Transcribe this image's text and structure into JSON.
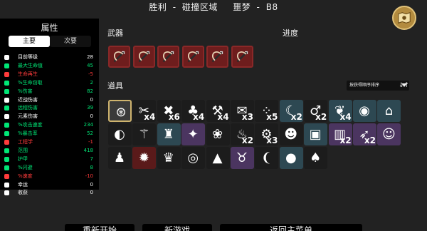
{
  "header": {
    "result": "胜利",
    "sep1": "-",
    "zone": "碰撞区域",
    "difficulty": "噩梦",
    "sep2": "-",
    "stage": "B8"
  },
  "stats_panel": {
    "title": "属性",
    "tabs": [
      {
        "label": "主要",
        "active": true
      },
      {
        "label": "次要",
        "active": false
      }
    ],
    "rows": [
      {
        "label": "目前等级",
        "value": "28",
        "color": "#ffffff",
        "icon": "level-icon"
      },
      {
        "label": "最大生命值",
        "value": "45",
        "color": "#00e676",
        "icon": "heart-icon"
      },
      {
        "label": "生命再生",
        "value": "-5",
        "color": "#ff3b3b",
        "icon": "regen-icon"
      },
      {
        "label": "%生命窃取",
        "value": "2",
        "color": "#00e676",
        "icon": "lifesteal-icon"
      },
      {
        "label": "%伤害",
        "value": "82",
        "color": "#00e676",
        "icon": "damage-icon"
      },
      {
        "label": "近战伤害",
        "value": "0",
        "color": "#ffffff",
        "icon": "melee-icon"
      },
      {
        "label": "远程伤害",
        "value": "39",
        "color": "#00e676",
        "icon": "ranged-icon"
      },
      {
        "label": "元素伤害",
        "value": "0",
        "color": "#ffffff",
        "icon": "elemental-icon"
      },
      {
        "label": "%攻击速度",
        "value": "234",
        "color": "#00e676",
        "icon": "attack-speed-icon"
      },
      {
        "label": "%暴击率",
        "value": "52",
        "color": "#00e676",
        "icon": "crit-icon"
      },
      {
        "label": "工程学",
        "value": "-1",
        "color": "#ff3b3b",
        "icon": "engineering-icon"
      },
      {
        "label": "范围",
        "value": "418",
        "color": "#00e676",
        "icon": "range-icon"
      },
      {
        "label": "护甲",
        "value": "7",
        "color": "#00e676",
        "icon": "armor-icon"
      },
      {
        "label": "%闪避",
        "value": "8",
        "color": "#00e676",
        "icon": "dodge-icon"
      },
      {
        "label": "%速度",
        "value": "-10",
        "color": "#ff3b3b",
        "icon": "speed-icon"
      },
      {
        "label": "幸运",
        "value": "0",
        "color": "#ffffff",
        "icon": "luck-icon"
      },
      {
        "label": "收获",
        "value": "0",
        "color": "#ffffff",
        "icon": "harvest-icon"
      }
    ]
  },
  "weapons": {
    "title": "武器",
    "count": 6,
    "icon": "crossbow-icon",
    "color": "#6e1d1d"
  },
  "progress": {
    "title": "进度"
  },
  "items": {
    "title": "道具",
    "sort_label": "按获得顺序排序",
    "sort_order_glyph": "↓↑",
    "list": [
      {
        "tier": "selected",
        "icon": "bag-icon",
        "glyph": "⊛",
        "count": ""
      },
      {
        "tier": "common",
        "icon": "knife-icon",
        "glyph": "✂",
        "count": "x4"
      },
      {
        "tier": "common",
        "icon": "dagger-icon",
        "glyph": "✖",
        "count": "x6"
      },
      {
        "tier": "common",
        "icon": "tree-icon",
        "glyph": "♣",
        "count": "x4"
      },
      {
        "tier": "common",
        "icon": "dumbbell-icon",
        "glyph": "⚒",
        "count": "x4"
      },
      {
        "tier": "common",
        "icon": "scroll-icon",
        "glyph": "✉",
        "count": "x3"
      },
      {
        "tier": "common",
        "icon": "pearl-icon",
        "glyph": "⁘",
        "count": "x5"
      },
      {
        "tier": "uncommon",
        "icon": "scythe-icon",
        "glyph": "☾",
        "count": "x2"
      },
      {
        "tier": "common",
        "icon": "leech-icon",
        "glyph": "♂",
        "count": "x2"
      },
      {
        "tier": "uncommon",
        "icon": "wings-icon",
        "glyph": "❦",
        "count": "x4"
      },
      {
        "tier": "uncommon",
        "icon": "orb-icon",
        "glyph": "◉",
        "count": ""
      },
      {
        "tier": "uncommon",
        "icon": "fort-icon",
        "glyph": "⌂",
        "count": ""
      },
      {
        "tier": "common",
        "icon": "egg-icon",
        "glyph": "◐",
        "count": ""
      },
      {
        "tier": "common",
        "icon": "reaper-icon",
        "glyph": "⚚",
        "count": ""
      },
      {
        "tier": "uncommon",
        "icon": "cape-icon",
        "glyph": "♜",
        "count": ""
      },
      {
        "tier": "rare",
        "icon": "wand-icon",
        "glyph": "✦",
        "count": ""
      },
      {
        "tier": "common",
        "icon": "bunny-icon",
        "glyph": "❀",
        "count": ""
      },
      {
        "tier": "common",
        "icon": "meat-icon",
        "glyph": "♨",
        "count": "x2"
      },
      {
        "tier": "common",
        "icon": "bolts-icon",
        "glyph": "⚙",
        "count": "x3"
      },
      {
        "tier": "common",
        "icon": "ghost-icon",
        "glyph": "☻",
        "count": ""
      },
      {
        "tier": "uncommon",
        "icon": "chest-icon",
        "glyph": "▣",
        "count": ""
      },
      {
        "tier": "rare",
        "icon": "curtain-icon",
        "glyph": "▥",
        "count": "x2"
      },
      {
        "tier": "rare",
        "icon": "bullet-icon",
        "glyph": "➶",
        "count": "x2"
      },
      {
        "tier": "rare",
        "icon": "pig-icon",
        "glyph": "☺",
        "count": ""
      },
      {
        "tier": "common",
        "icon": "robot-icon",
        "glyph": "♟",
        "count": ""
      },
      {
        "tier": "legendary",
        "icon": "saw-icon",
        "glyph": "✹",
        "count": ""
      },
      {
        "tier": "common",
        "icon": "crown-icon",
        "glyph": "♛",
        "count": ""
      },
      {
        "tier": "common",
        "icon": "spiral-icon",
        "glyph": "◎",
        "count": ""
      },
      {
        "tier": "common",
        "icon": "cone-icon",
        "glyph": "▲",
        "count": ""
      },
      {
        "tier": "rare",
        "icon": "demon-icon",
        "glyph": "♉",
        "count": ""
      },
      {
        "tier": "common",
        "icon": "fang-icon",
        "glyph": "❨",
        "count": ""
      },
      {
        "tier": "uncommon",
        "icon": "grenade-icon",
        "glyph": "●",
        "count": ""
      },
      {
        "tier": "common",
        "icon": "mushroom-icon",
        "glyph": "♠",
        "count": ""
      }
    ]
  },
  "footer": {
    "restart": "重新开始",
    "new_run": "新游戏",
    "main_menu": "返回主菜单"
  }
}
